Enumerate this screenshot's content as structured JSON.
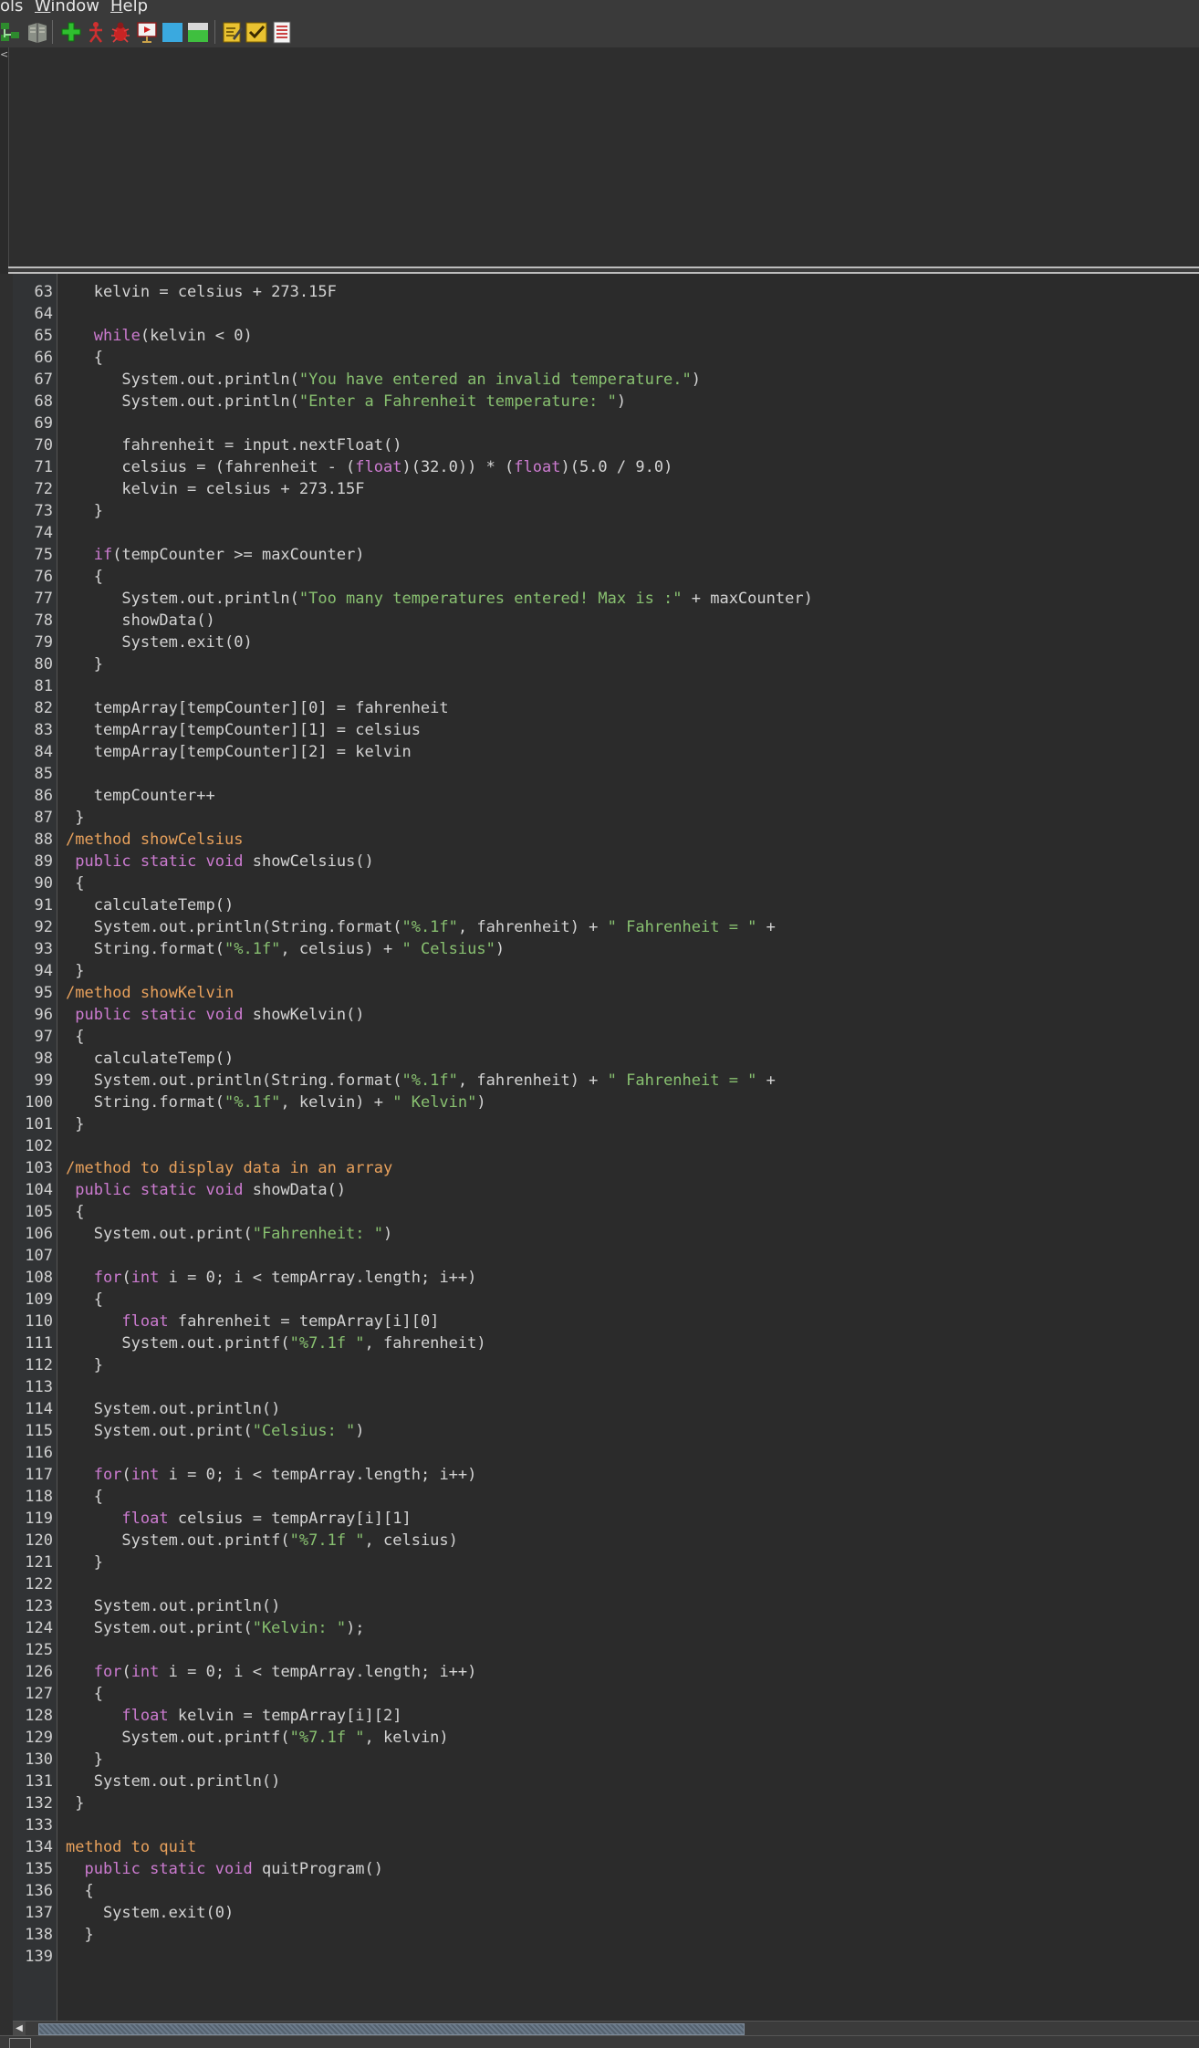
{
  "menubar": {
    "tools_partial": "ols",
    "window_mnemonic": "W",
    "window_rest": "indow",
    "help_mnemonic": "H",
    "help_rest": "elp"
  },
  "toolbar": {
    "buttons": [
      "compile-tree-icon",
      "book-icon",
      "add-green-plus-icon",
      "run-figure-icon",
      "debug-bug-icon",
      "presentation-icon",
      "cyan-square-icon",
      "green-window-icon",
      "edit-note-icon",
      "checklist-icon",
      "document-list-icon"
    ]
  },
  "upper_pane": {
    "collapse_arrow": "<"
  },
  "editor": {
    "lines": [
      {
        "n": "63",
        "t": [
          [
            "",
            "   kelvin = celsius + 273.15F"
          ]
        ]
      },
      {
        "n": "64",
        "t": []
      },
      {
        "n": "65",
        "t": [
          [
            "",
            "   "
          ],
          [
            "kw",
            "while"
          ],
          [
            "",
            "(kelvin < 0)"
          ]
        ]
      },
      {
        "n": "66",
        "t": [
          [
            "",
            "   {"
          ]
        ]
      },
      {
        "n": "67",
        "t": [
          [
            "",
            "      System.out.println("
          ],
          [
            "str",
            "\"You have entered an invalid temperature.\""
          ],
          [
            "",
            ")"
          ]
        ]
      },
      {
        "n": "68",
        "t": [
          [
            "",
            "      System.out.println("
          ],
          [
            "str",
            "\"Enter a Fahrenheit temperature: \""
          ],
          [
            "",
            ")"
          ]
        ]
      },
      {
        "n": "69",
        "t": []
      },
      {
        "n": "70",
        "t": [
          [
            "",
            "      fahrenheit = input.nextFloat()"
          ]
        ]
      },
      {
        "n": "71",
        "t": [
          [
            "",
            "      celsius = (fahrenheit - ("
          ],
          [
            "kw",
            "float"
          ],
          [
            "",
            ")(32.0)) * ("
          ],
          [
            "kw",
            "float"
          ],
          [
            "",
            ")(5.0 / 9.0)"
          ]
        ]
      },
      {
        "n": "72",
        "t": [
          [
            "",
            "      kelvin = celsius + 273.15F"
          ]
        ]
      },
      {
        "n": "73",
        "t": [
          [
            "",
            "   }"
          ]
        ]
      },
      {
        "n": "74",
        "t": []
      },
      {
        "n": "75",
        "t": [
          [
            "",
            "   "
          ],
          [
            "kw",
            "if"
          ],
          [
            "",
            "(tempCounter >= maxCounter)"
          ]
        ]
      },
      {
        "n": "76",
        "t": [
          [
            "",
            "   {"
          ]
        ]
      },
      {
        "n": "77",
        "t": [
          [
            "",
            "      System.out.println("
          ],
          [
            "str",
            "\"Too many temperatures entered! Max is :\""
          ],
          [
            "",
            " + maxCounter)"
          ]
        ]
      },
      {
        "n": "78",
        "t": [
          [
            "",
            "      showData()"
          ]
        ]
      },
      {
        "n": "79",
        "t": [
          [
            "",
            "      System.exit(0)"
          ]
        ]
      },
      {
        "n": "80",
        "t": [
          [
            "",
            "   }"
          ]
        ]
      },
      {
        "n": "81",
        "t": []
      },
      {
        "n": "82",
        "t": [
          [
            "",
            "   tempArray[tempCounter][0] = fahrenheit"
          ]
        ]
      },
      {
        "n": "83",
        "t": [
          [
            "",
            "   tempArray[tempCounter][1] = celsius"
          ]
        ]
      },
      {
        "n": "84",
        "t": [
          [
            "",
            "   tempArray[tempCounter][2] = kelvin"
          ]
        ]
      },
      {
        "n": "85",
        "t": []
      },
      {
        "n": "86",
        "t": [
          [
            "",
            "   tempCounter++"
          ]
        ]
      },
      {
        "n": "87",
        "t": [
          [
            "",
            " }"
          ]
        ]
      },
      {
        "n": "88",
        "t": [
          [
            "cm",
            "/method showCelsius"
          ]
        ]
      },
      {
        "n": "89",
        "t": [
          [
            "",
            " "
          ],
          [
            "kw",
            "public static void"
          ],
          [
            "",
            " showCelsius()"
          ]
        ]
      },
      {
        "n": "90",
        "t": [
          [
            "",
            " {"
          ]
        ]
      },
      {
        "n": "91",
        "t": [
          [
            "",
            "   calculateTemp()"
          ]
        ]
      },
      {
        "n": "92",
        "t": [
          [
            "",
            "   System.out.println(String.format("
          ],
          [
            "str",
            "\"%.1f\""
          ],
          [
            "",
            ", fahrenheit) + "
          ],
          [
            "str",
            "\" Fahrenheit = \""
          ],
          [
            "",
            " +"
          ]
        ]
      },
      {
        "n": "93",
        "t": [
          [
            "",
            "   String.format("
          ],
          [
            "str",
            "\"%.1f\""
          ],
          [
            "",
            ", celsius) + "
          ],
          [
            "str",
            "\" Celsius\""
          ],
          [
            "",
            ")"
          ]
        ]
      },
      {
        "n": "94",
        "t": [
          [
            "",
            " }"
          ]
        ]
      },
      {
        "n": "95",
        "t": [
          [
            "cm",
            "/method showKelvin"
          ]
        ]
      },
      {
        "n": "96",
        "t": [
          [
            "",
            " "
          ],
          [
            "kw",
            "public static void"
          ],
          [
            "",
            " showKelvin()"
          ]
        ]
      },
      {
        "n": "97",
        "t": [
          [
            "",
            " {"
          ]
        ]
      },
      {
        "n": "98",
        "t": [
          [
            "",
            "   calculateTemp()"
          ]
        ]
      },
      {
        "n": "99",
        "t": [
          [
            "",
            "   System.out.println(String.format("
          ],
          [
            "str",
            "\"%.1f\""
          ],
          [
            "",
            ", fahrenheit) + "
          ],
          [
            "str",
            "\" Fahrenheit = \""
          ],
          [
            "",
            " +"
          ]
        ]
      },
      {
        "n": "100",
        "t": [
          [
            "",
            "   String.format("
          ],
          [
            "str",
            "\"%.1f\""
          ],
          [
            "",
            ", kelvin) + "
          ],
          [
            "str",
            "\" Kelvin\""
          ],
          [
            "",
            ")"
          ]
        ]
      },
      {
        "n": "101",
        "t": [
          [
            "",
            " }"
          ]
        ]
      },
      {
        "n": "102",
        "t": []
      },
      {
        "n": "103",
        "t": [
          [
            "cm",
            "/method to display data in an array"
          ]
        ]
      },
      {
        "n": "104",
        "t": [
          [
            "",
            " "
          ],
          [
            "kw",
            "public static void"
          ],
          [
            "",
            " showData()"
          ]
        ]
      },
      {
        "n": "105",
        "t": [
          [
            "",
            " {"
          ]
        ]
      },
      {
        "n": "106",
        "t": [
          [
            "",
            "   System.out.print("
          ],
          [
            "str",
            "\"Fahrenheit: \""
          ],
          [
            "",
            ")"
          ]
        ]
      },
      {
        "n": "107",
        "t": []
      },
      {
        "n": "108",
        "t": [
          [
            "",
            "   "
          ],
          [
            "kw",
            "for"
          ],
          [
            "",
            "("
          ],
          [
            "kw",
            "int"
          ],
          [
            "",
            " i = 0; i < tempArray.length; i++)"
          ]
        ]
      },
      {
        "n": "109",
        "t": [
          [
            "",
            "   {"
          ]
        ]
      },
      {
        "n": "110",
        "t": [
          [
            "",
            "      "
          ],
          [
            "kw",
            "float"
          ],
          [
            "",
            " fahrenheit = tempArray[i][0]"
          ]
        ]
      },
      {
        "n": "111",
        "t": [
          [
            "",
            "      System.out.printf("
          ],
          [
            "str",
            "\"%7.1f \""
          ],
          [
            "",
            ", fahrenheit)"
          ]
        ]
      },
      {
        "n": "112",
        "t": [
          [
            "",
            "   }"
          ]
        ]
      },
      {
        "n": "113",
        "t": []
      },
      {
        "n": "114",
        "t": [
          [
            "",
            "   System.out.println()"
          ]
        ]
      },
      {
        "n": "115",
        "t": [
          [
            "",
            "   System.out.print("
          ],
          [
            "str",
            "\"Celsius: \""
          ],
          [
            "",
            ")"
          ]
        ]
      },
      {
        "n": "116",
        "t": []
      },
      {
        "n": "117",
        "t": [
          [
            "",
            "   "
          ],
          [
            "kw",
            "for"
          ],
          [
            "",
            "("
          ],
          [
            "kw",
            "int"
          ],
          [
            "",
            " i = 0; i < tempArray.length; i++)"
          ]
        ]
      },
      {
        "n": "118",
        "t": [
          [
            "",
            "   {"
          ]
        ]
      },
      {
        "n": "119",
        "t": [
          [
            "",
            "      "
          ],
          [
            "kw",
            "float"
          ],
          [
            "",
            " celsius = tempArray[i][1]"
          ]
        ]
      },
      {
        "n": "120",
        "t": [
          [
            "",
            "      System.out.printf("
          ],
          [
            "str",
            "\"%7.1f \""
          ],
          [
            "",
            ", celsius)"
          ]
        ]
      },
      {
        "n": "121",
        "t": [
          [
            "",
            "   }"
          ]
        ]
      },
      {
        "n": "122",
        "t": []
      },
      {
        "n": "123",
        "t": [
          [
            "",
            "   System.out.println()"
          ]
        ]
      },
      {
        "n": "124",
        "t": [
          [
            "",
            "   System.out.print("
          ],
          [
            "str",
            "\"Kelvin: \""
          ],
          [
            "",
            ");"
          ]
        ]
      },
      {
        "n": "125",
        "t": []
      },
      {
        "n": "126",
        "t": [
          [
            "",
            "   "
          ],
          [
            "kw",
            "for"
          ],
          [
            "",
            "("
          ],
          [
            "kw",
            "int"
          ],
          [
            "",
            " i = 0; i < tempArray.length; i++)"
          ]
        ]
      },
      {
        "n": "127",
        "t": [
          [
            "",
            "   {"
          ]
        ]
      },
      {
        "n": "128",
        "t": [
          [
            "",
            "      "
          ],
          [
            "kw",
            "float"
          ],
          [
            "",
            " kelvin = tempArray[i][2]"
          ]
        ]
      },
      {
        "n": "129",
        "t": [
          [
            "",
            "      System.out.printf("
          ],
          [
            "str",
            "\"%7.1f \""
          ],
          [
            "",
            ", kelvin)"
          ]
        ]
      },
      {
        "n": "130",
        "t": [
          [
            "",
            "   }"
          ]
        ]
      },
      {
        "n": "131",
        "t": [
          [
            "",
            "   System.out.println()"
          ]
        ]
      },
      {
        "n": "132",
        "t": [
          [
            "",
            " }"
          ]
        ]
      },
      {
        "n": "133",
        "t": []
      },
      {
        "n": "134",
        "t": [
          [
            "cm",
            "method to quit"
          ]
        ]
      },
      {
        "n": "135",
        "t": [
          [
            "",
            "  "
          ],
          [
            "kw",
            "public static void"
          ],
          [
            "",
            " quitProgram()"
          ]
        ]
      },
      {
        "n": "136",
        "t": [
          [
            "",
            "  {"
          ]
        ]
      },
      {
        "n": "137",
        "t": [
          [
            "",
            "    System.exit(0)"
          ]
        ]
      },
      {
        "n": "138",
        "t": [
          [
            "",
            "  }"
          ]
        ]
      },
      {
        "n": "139",
        "t": []
      }
    ]
  },
  "hscroll": {
    "left_arrow": "◀",
    "position": 0.0
  }
}
